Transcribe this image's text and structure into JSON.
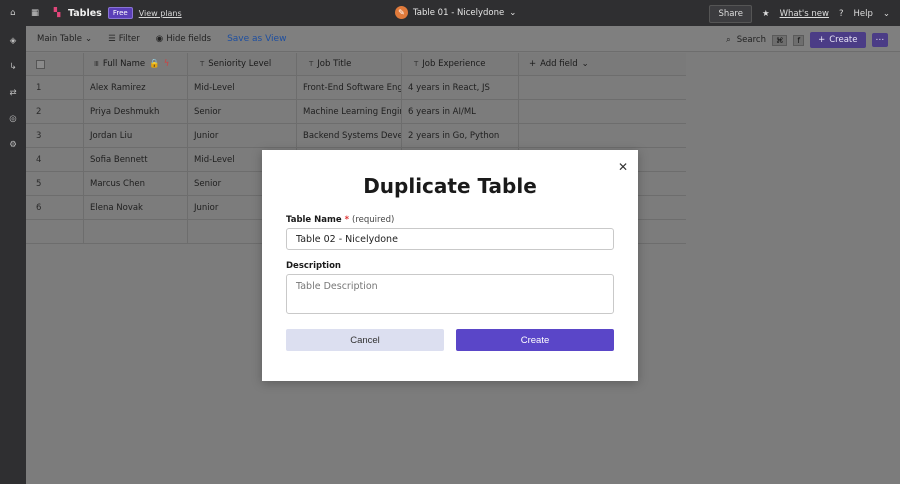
{
  "topbar": {
    "app_name": "Tables",
    "plan_badge": "Free",
    "view_plans": "View plans",
    "table_title": "Table 01 - Nicelydone",
    "share": "Share",
    "whats_new": "What's new",
    "help": "Help"
  },
  "toolbar": {
    "view_name": "Main Table",
    "filter": "Filter",
    "hide_fields": "Hide fields",
    "save_view": "Save as View",
    "search": "Search",
    "shortcut_cmd": "⌘",
    "shortcut_key": "f",
    "create": "Create"
  },
  "table": {
    "columns": [
      {
        "label": "Full Name",
        "type_icon": "Ⅲ"
      },
      {
        "label": "Seniority Level",
        "type_icon": "T"
      },
      {
        "label": "Job Title",
        "type_icon": "T"
      },
      {
        "label": "Job Experience",
        "type_icon": "T"
      }
    ],
    "add_field": "Add field",
    "rows": [
      {
        "num": "1",
        "name": "Alex Ramirez",
        "level": "Mid-Level",
        "title": "Front-End Software Engineer",
        "exp": "4 years in React, JS"
      },
      {
        "num": "2",
        "name": "Priya Deshmukh",
        "level": "Senior",
        "title": "Machine Learning Engineer",
        "exp": "6 years in AI/ML"
      },
      {
        "num": "3",
        "name": "Jordan Liu",
        "level": "Junior",
        "title": "Backend Systems Developer",
        "exp": "2 years in Go, Python"
      },
      {
        "num": "4",
        "name": "Sofia Bennett",
        "level": "Mid-Level",
        "title": "",
        "exp": ""
      },
      {
        "num": "5",
        "name": "Marcus Chen",
        "level": "Senior",
        "title": "",
        "exp": ""
      },
      {
        "num": "6",
        "name": "Elena Novak",
        "level": "Junior",
        "title": "",
        "exp": ""
      }
    ]
  },
  "dialog": {
    "title": "Duplicate Table",
    "table_name_label": "Table Name",
    "required_mark": "*",
    "required_hint": "(required)",
    "table_name_value": "Table 02 - Nicelydone",
    "description_label": "Description",
    "description_placeholder": "Table Description",
    "cancel": "Cancel",
    "create": "Create"
  }
}
